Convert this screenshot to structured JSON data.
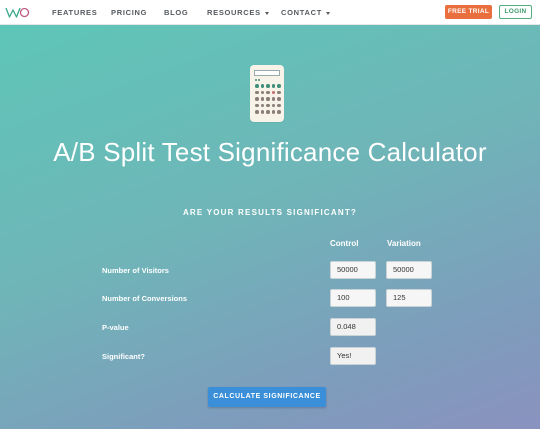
{
  "nav": {
    "logo_name": "vwo-logo-icon",
    "links": [
      {
        "label": "FEATURES",
        "dropdown": false
      },
      {
        "label": "PRICING",
        "dropdown": false
      },
      {
        "label": "BLOG",
        "dropdown": false
      },
      {
        "label": "RESOURCES",
        "dropdown": true
      },
      {
        "label": "CONTACT",
        "dropdown": true
      }
    ],
    "free_trial_label": "FREE TRIAL",
    "login_label": "LOGIN"
  },
  "hero": {
    "icon": "calculator-icon",
    "title": "A/B Split Test Significance Calculator",
    "subtitle": "ARE YOUR RESULTS SIGNIFICANT?"
  },
  "calculator": {
    "columns": [
      "Control",
      "Variation"
    ],
    "rows": [
      {
        "label": "Number of Visitors",
        "control": "50000",
        "variation": "50000"
      },
      {
        "label": "Number of Conversions",
        "control": "100",
        "variation": "125"
      },
      {
        "label": "P-value",
        "control": "0.048"
      },
      {
        "label": "Significant?",
        "control": "Yes!"
      }
    ],
    "button_label": "CALCULATE SIGNIFICANCE"
  },
  "colors": {
    "trial_button": "#e96f3f",
    "login_border": "#52b07f",
    "calc_button": "#3a8fd8",
    "gradient_start": "#5ec6b8",
    "gradient_end": "#8a92bf"
  }
}
